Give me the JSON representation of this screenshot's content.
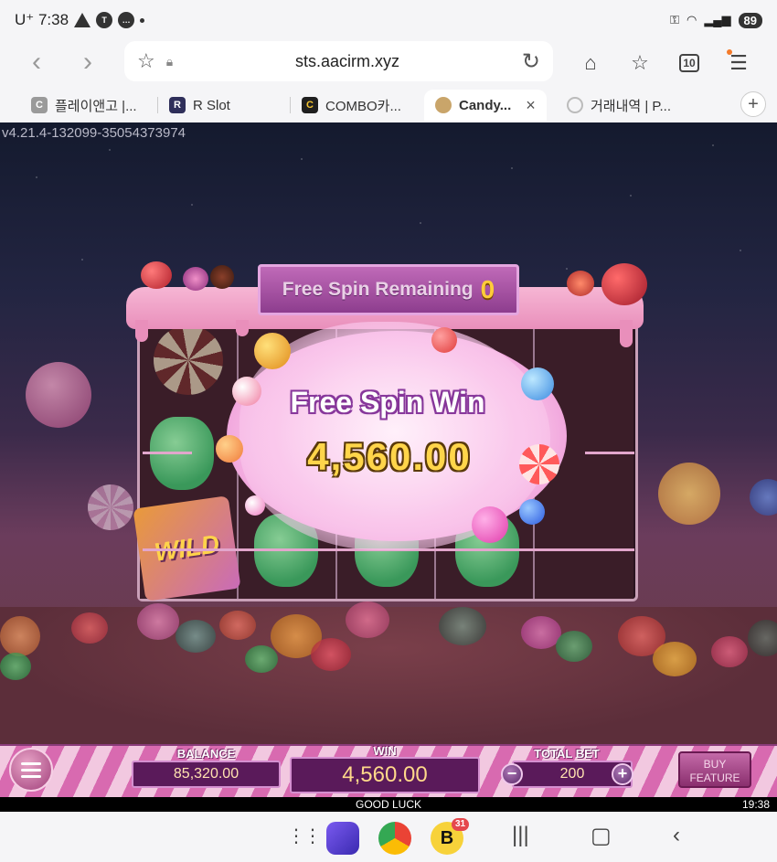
{
  "status_bar": {
    "carrier": "U⁺ 7:38",
    "battery": "89",
    "icons": [
      "warning-icon",
      "talk-icon",
      "chat-icon",
      "dot-icon",
      "key-icon",
      "wifi-icon",
      "signal-icon"
    ]
  },
  "browser": {
    "url": "sts.aacirm.xyz",
    "tab_count": "10",
    "tabs": [
      {
        "label": "플레이앤고 |...",
        "fav_letter": "C",
        "fav_color": "#9a9a9a"
      },
      {
        "label": "R Slot",
        "fav_letter": "R",
        "fav_color": "#2f2f5a"
      },
      {
        "label": "COMBO카...",
        "fav_letter": "C",
        "fav_color": "#1f1f1f"
      },
      {
        "label": "Candy...",
        "fav_letter": "",
        "fav_color": "#c9a56a"
      },
      {
        "label": "거래내역 | P...",
        "fav_letter": "",
        "fav_color": "#ffffff"
      }
    ],
    "close_glyph": "×"
  },
  "game": {
    "version": "v4.21.4-132099-35054373974",
    "remaining_label": "Free Spin Remaining",
    "remaining_count": "0",
    "popup_title": "Free Spin Win",
    "popup_amount": "4,560.00",
    "wild_label": "WILD",
    "balance_label": "BALANCE",
    "balance_value": "85,320.00",
    "win_label": "WIN",
    "win_value": "4,560.00",
    "bet_label": "TOTAL BET",
    "bet_value": "200",
    "buy_label_1": "BUY",
    "buy_label_2": "FEATURE",
    "footer_text": "GOOD LUCK",
    "clock": "19:38",
    "colors": {
      "accent_pink": "#d86ab0",
      "gold": "#ffd54a",
      "panel": "#5a1a5a"
    }
  },
  "android_nav": {
    "badge_count": "31",
    "icons": [
      "app-grid-icon",
      "internet-app-icon",
      "chrome-icon",
      "b-app-icon",
      "recents-icon",
      "home-icon",
      "back-icon"
    ]
  }
}
